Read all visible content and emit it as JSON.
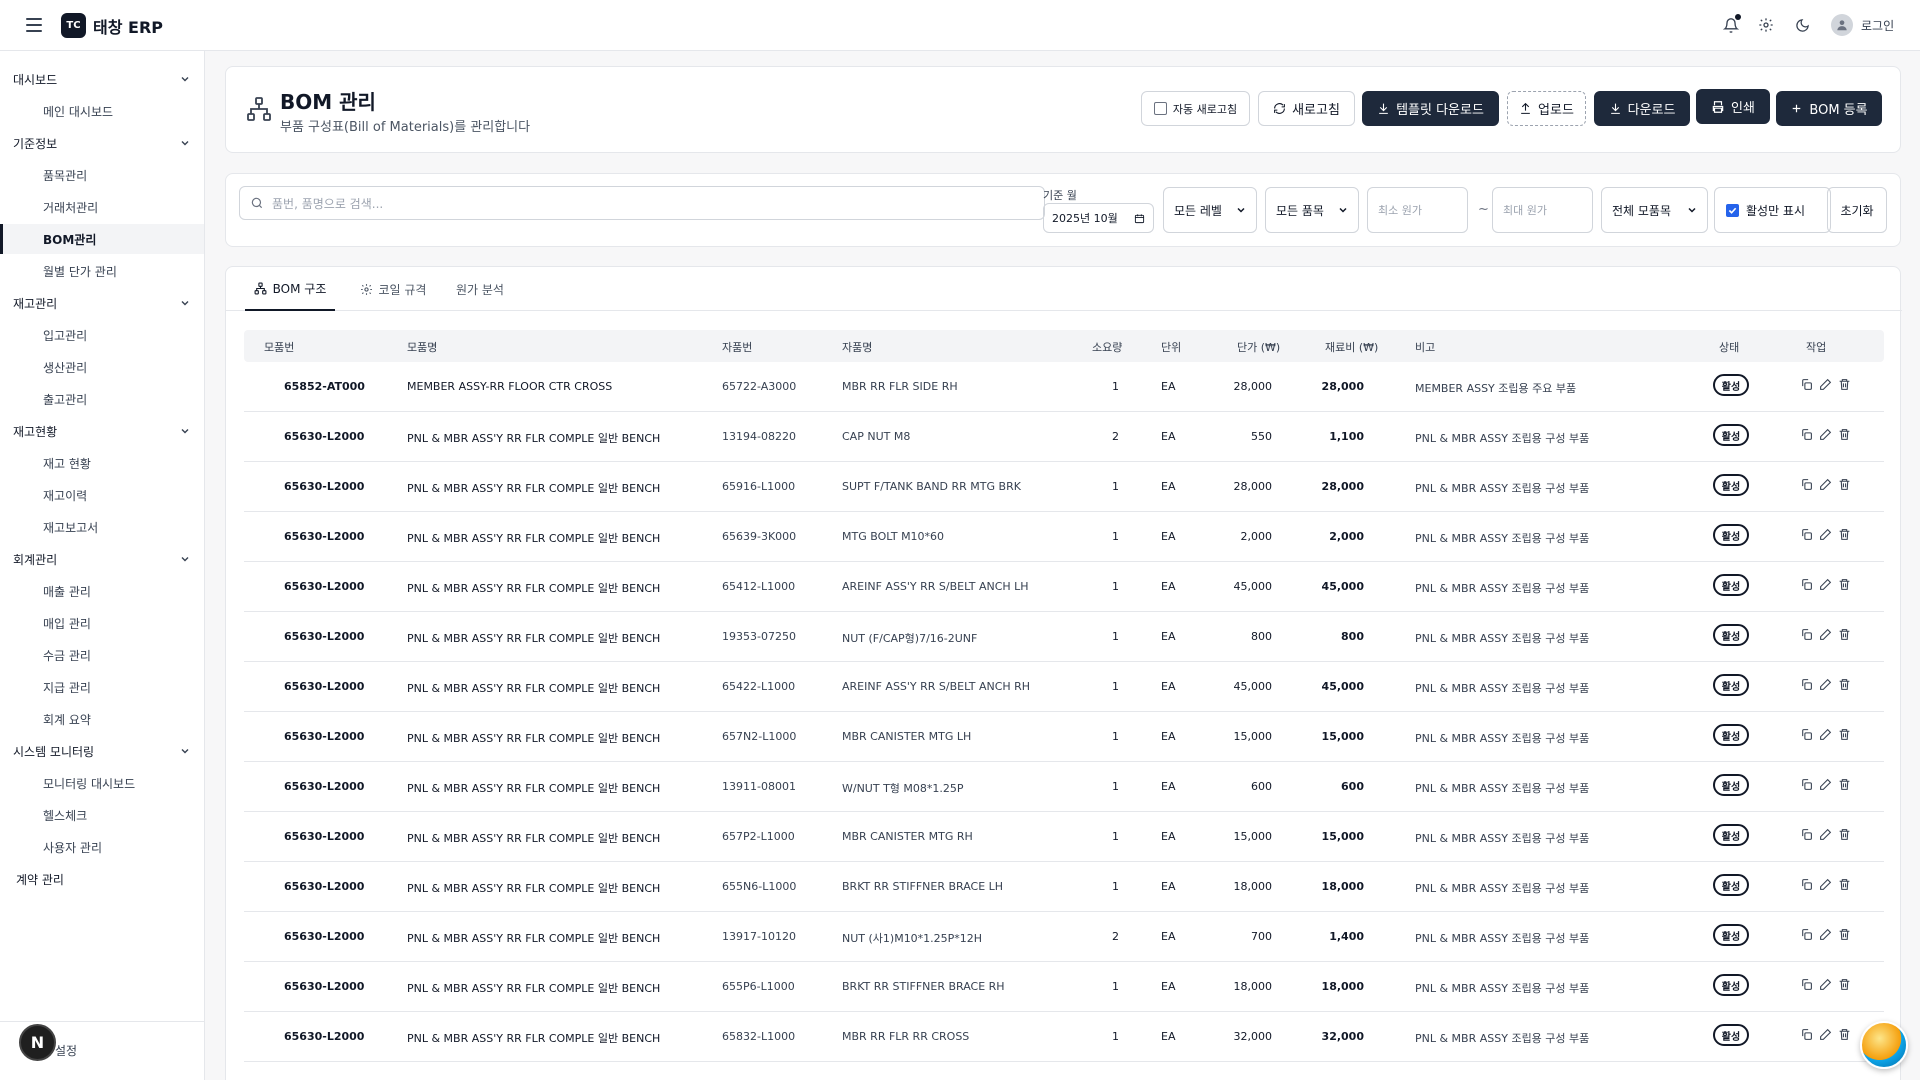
{
  "app": {
    "logo": "TC",
    "name": "태창 ERP",
    "login": "로그인"
  },
  "sidebar": {
    "groups": [
      {
        "label": "대시보드",
        "items": [
          "메인 대시보드"
        ]
      },
      {
        "label": "기준정보",
        "items": [
          "품목관리",
          "거래처관리",
          "BOM관리",
          "월별 단가 관리"
        ]
      },
      {
        "label": "재고관리",
        "items": [
          "입고관리",
          "생산관리",
          "출고관리"
        ]
      },
      {
        "label": "재고현황",
        "items": [
          "재고 현황",
          "재고이력",
          "재고보고서"
        ]
      },
      {
        "label": "회계관리",
        "items": [
          "매출 관리",
          "매입 관리",
          "수금 관리",
          "지급 관리",
          "회계 요약"
        ]
      },
      {
        "label": "시스템 모니터링",
        "items": [
          "모니터링 대시보드",
          "헬스체크",
          "사용자 관리"
        ]
      }
    ],
    "extra": "계약 관리",
    "bottom": "설정",
    "n_badge": "N"
  },
  "header": {
    "title": "BOM 관리",
    "subtitle": "부품 구성표(Bill of Materials)를 관리합니다",
    "auto_refresh": "자동 새로고침",
    "refresh": "새로고침",
    "template_download": "템플릿 다운로드",
    "upload": "업로드",
    "download": "다운로드",
    "print": "인쇄",
    "register": "BOM 등록"
  },
  "filters": {
    "search_placeholder": "품번, 품명으로 검색...",
    "date_label": "기준 월",
    "date_value": "2025년 10월",
    "level": "모든 레벨",
    "item": "모든 품목",
    "min_cost": "최소 원가",
    "tilde": "~",
    "max_cost": "최대 원가",
    "parent": "전체 모품목",
    "active_only": "활성만 표시",
    "reset": "초기화"
  },
  "tabs": [
    "BOM 구조",
    "코일 규격",
    "원가 분석"
  ],
  "table": {
    "headers": [
      "모품번",
      "모품명",
      "자품번",
      "자품명",
      "소요량",
      "단위",
      "단가 (₩)",
      "재료비 (₩)",
      "비고",
      "상태",
      "작업"
    ],
    "rows": [
      [
        "65852-AT000",
        "MEMBER ASSY-RR FLOOR CTR CROSS",
        "65722-A3000",
        "MBR RR FLR SIDE RH",
        "1",
        "EA",
        "28,000",
        "28,000",
        "MEMBER ASSY 조립용 주요 부품",
        "활성"
      ],
      [
        "65630-L2000",
        "PNL & MBR ASS'Y RR FLR COMPLE 일반 BENCH",
        "13194-08220",
        "CAP NUT M8",
        "2",
        "EA",
        "550",
        "1,100",
        "PNL & MBR ASSY 조립용 구성 부품",
        "활성"
      ],
      [
        "65630-L2000",
        "PNL & MBR ASS'Y RR FLR COMPLE 일반 BENCH",
        "65916-L1000",
        "SUPT F/TANK BAND RR MTG BRK",
        "1",
        "EA",
        "28,000",
        "28,000",
        "PNL & MBR ASSY 조립용 구성 부품",
        "활성"
      ],
      [
        "65630-L2000",
        "PNL & MBR ASS'Y RR FLR COMPLE 일반 BENCH",
        "65639-3K000",
        "MTG BOLT M10*60",
        "1",
        "EA",
        "2,000",
        "2,000",
        "PNL & MBR ASSY 조립용 구성 부품",
        "활성"
      ],
      [
        "65630-L2000",
        "PNL & MBR ASS'Y RR FLR COMPLE 일반 BENCH",
        "65412-L1000",
        "AREINF ASS'Y RR S/BELT ANCH LH",
        "1",
        "EA",
        "45,000",
        "45,000",
        "PNL & MBR ASSY 조립용 구성 부품",
        "활성"
      ],
      [
        "65630-L2000",
        "PNL & MBR ASS'Y RR FLR COMPLE 일반 BENCH",
        "19353-07250",
        "NUT (F/CAP형)7/16-2UNF",
        "1",
        "EA",
        "800",
        "800",
        "PNL & MBR ASSY 조립용 구성 부품",
        "활성"
      ],
      [
        "65630-L2000",
        "PNL & MBR ASS'Y RR FLR COMPLE 일반 BENCH",
        "65422-L1000",
        "AREINF ASS'Y RR S/BELT ANCH RH",
        "1",
        "EA",
        "45,000",
        "45,000",
        "PNL & MBR ASSY 조립용 구성 부품",
        "활성"
      ],
      [
        "65630-L2000",
        "PNL & MBR ASS'Y RR FLR COMPLE 일반 BENCH",
        "657N2-L1000",
        "MBR CANISTER MTG LH",
        "1",
        "EA",
        "15,000",
        "15,000",
        "PNL & MBR ASSY 조립용 구성 부품",
        "활성"
      ],
      [
        "65630-L2000",
        "PNL & MBR ASS'Y RR FLR COMPLE 일반 BENCH",
        "13911-08001",
        "W/NUT T형 M08*1.25P",
        "1",
        "EA",
        "600",
        "600",
        "PNL & MBR ASSY 조립용 구성 부품",
        "활성"
      ],
      [
        "65630-L2000",
        "PNL & MBR ASS'Y RR FLR COMPLE 일반 BENCH",
        "657P2-L1000",
        "MBR CANISTER MTG RH",
        "1",
        "EA",
        "15,000",
        "15,000",
        "PNL & MBR ASSY 조립용 구성 부품",
        "활성"
      ],
      [
        "65630-L2000",
        "PNL & MBR ASS'Y RR FLR COMPLE 일반 BENCH",
        "655N6-L1000",
        "BRKT RR STIFFNER BRACE LH",
        "1",
        "EA",
        "18,000",
        "18,000",
        "PNL & MBR ASSY 조립용 구성 부품",
        "활성"
      ],
      [
        "65630-L2000",
        "PNL & MBR ASS'Y RR FLR COMPLE 일반 BENCH",
        "13917-10120",
        "NUT (사1)M10*1.25P*12H",
        "2",
        "EA",
        "700",
        "1,400",
        "PNL & MBR ASSY 조립용 구성 부품",
        "활성"
      ],
      [
        "65630-L2000",
        "PNL & MBR ASS'Y RR FLR COMPLE 일반 BENCH",
        "655P6-L1000",
        "BRKT RR STIFFNER BRACE RH",
        "1",
        "EA",
        "18,000",
        "18,000",
        "PNL & MBR ASSY 조립용 구성 부품",
        "활성"
      ],
      [
        "65630-L2000",
        "PNL & MBR ASS'Y RR FLR COMPLE 일반 BENCH",
        "65832-L1000",
        "MBR RR FLR RR CROSS",
        "1",
        "EA",
        "32,000",
        "32,000",
        "PNL & MBR ASSY 조립용 구성 부품",
        "활성"
      ]
    ]
  }
}
